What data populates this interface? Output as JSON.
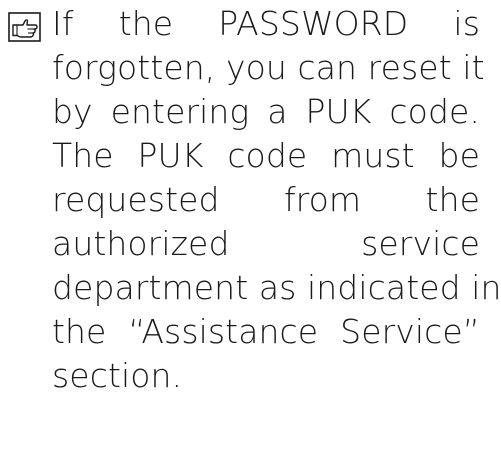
{
  "note": {
    "icon": "pointing-hand-icon",
    "lines": [
      "If the PASSWORD is",
      "forgotten, you can reset it",
      "by entering a PUK code.",
      "The PUK code must be",
      "requested from the",
      "authorized service",
      "department as indicated in",
      "the “Assistance Service”",
      "section."
    ]
  }
}
